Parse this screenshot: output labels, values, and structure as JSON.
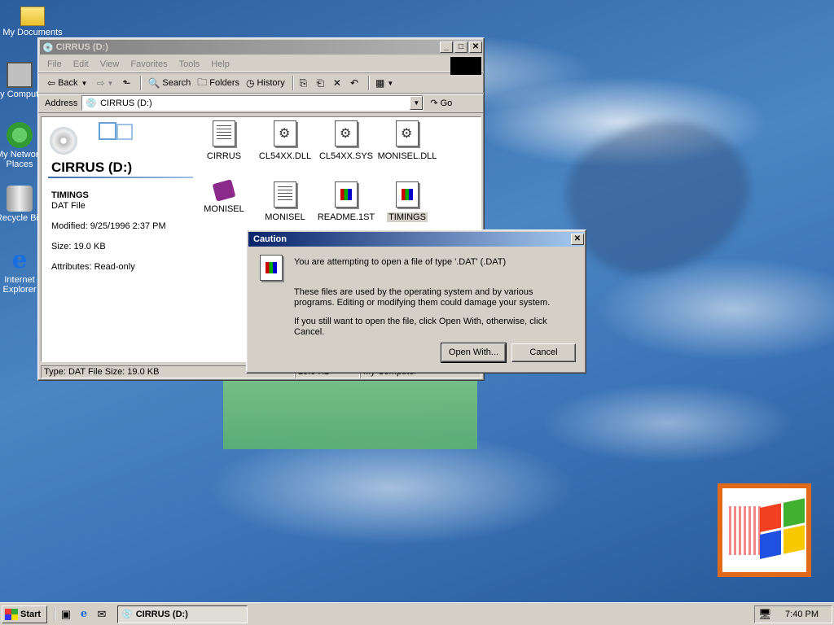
{
  "desktop": {
    "icons": [
      {
        "label": "My Documents",
        "icon": "folder-icon"
      },
      {
        "label": "My Computer",
        "icon": "computer-icon"
      },
      {
        "label": "My Network Places",
        "icon": "network-icon"
      },
      {
        "label": "Recycle Bin",
        "icon": "recycle-bin-icon"
      },
      {
        "label": "Internet Explorer",
        "icon": "ie-icon"
      }
    ]
  },
  "window": {
    "title": "CIRRUS (D:)",
    "menu": [
      "File",
      "Edit",
      "View",
      "Favorites",
      "Tools",
      "Help"
    ],
    "toolbar": {
      "back": "Back",
      "search": "Search",
      "folders": "Folders",
      "history": "History"
    },
    "address": {
      "label": "Address",
      "value": "CIRRUS (D:)",
      "go": "Go"
    },
    "left_pane": {
      "drive_title": "CIRRUS (D:)",
      "file_name": "TIMINGS",
      "file_type": "DAT File",
      "modified": "Modified: 9/25/1996 2:37 PM",
      "size": "Size: 19.0 KB",
      "attributes": "Attributes: Read-only"
    },
    "files": [
      {
        "name": "CIRRUS",
        "icon": "text-document-icon"
      },
      {
        "name": "CL54XX.DLL",
        "icon": "gear-file-icon"
      },
      {
        "name": "CL54XX.SYS",
        "icon": "gear-file-icon"
      },
      {
        "name": "MONISEL.DLL",
        "icon": "gear-file-icon"
      },
      {
        "name": "MONISEL",
        "icon": "help-book-icon"
      },
      {
        "name": "MONISEL",
        "icon": "text-document-icon"
      },
      {
        "name": "README.1ST",
        "icon": "windows-file-icon"
      },
      {
        "name": "TIMINGS",
        "icon": "windows-file-icon"
      }
    ],
    "status": {
      "text": "Type: DAT File Size: 19.0 KB",
      "size": "19.0 KB",
      "zone": "My Computer"
    }
  },
  "dialog": {
    "title": "Caution",
    "line1": "You are attempting to open a file of type '.DAT' (.DAT)",
    "line2": "These files are used by the operating system and by various programs. Editing or modifying them could damage your system.",
    "line3": "If you still want to open the file, click Open With, otherwise, click Cancel.",
    "open_with": "Open With...",
    "cancel": "Cancel"
  },
  "taskbar": {
    "start": "Start",
    "task": "CIRRUS (D:)",
    "clock": "7:40 PM"
  },
  "colors": {
    "title_active": "#0a246a",
    "desktop": "#3a73b6",
    "face": "#d4d0c8"
  }
}
